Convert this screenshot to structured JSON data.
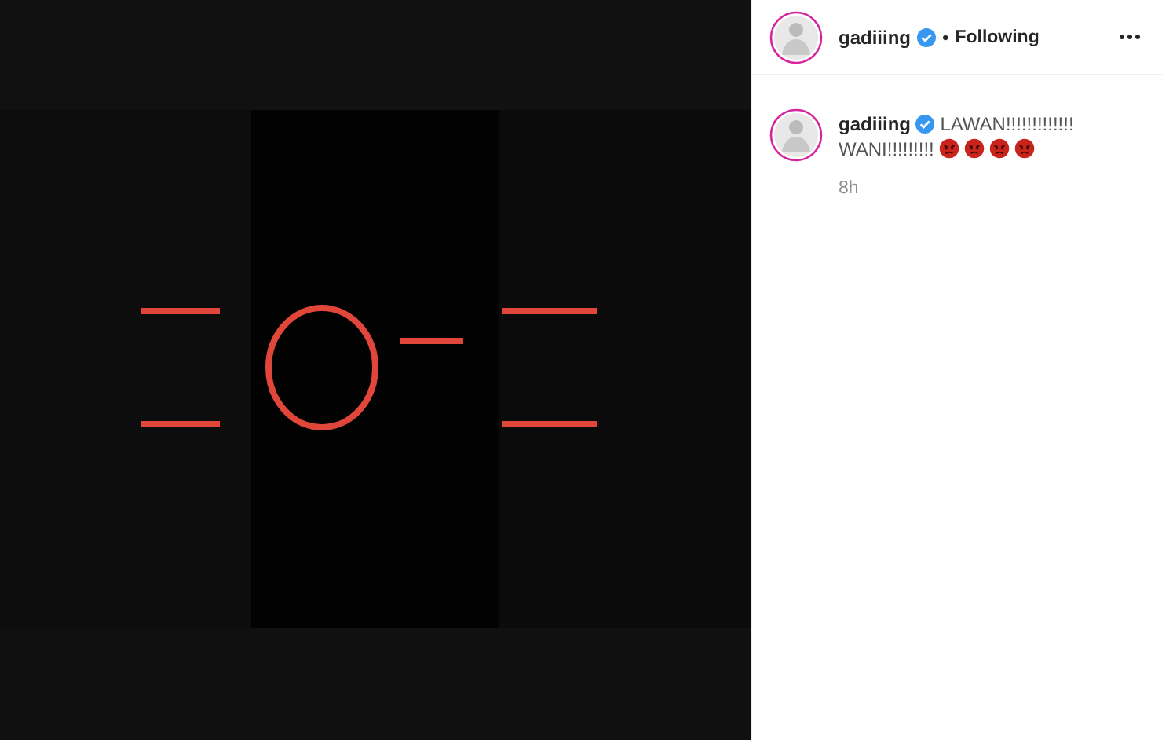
{
  "post": {
    "header": {
      "username": "gadiiing",
      "verified": true,
      "separator": "•",
      "follow_status": "Following"
    },
    "caption": {
      "username": "gadiiing",
      "verified": true,
      "text_lines": [
        "LAWAN!!!!!!!!!!!!!",
        "WANI!!!!!!!!!"
      ],
      "emojis": [
        {
          "kind": "angry-face"
        },
        {
          "kind": "angry-face"
        },
        {
          "kind": "angry-face"
        },
        {
          "kind": "angry-face"
        }
      ]
    },
    "timestamp": "8h"
  }
}
